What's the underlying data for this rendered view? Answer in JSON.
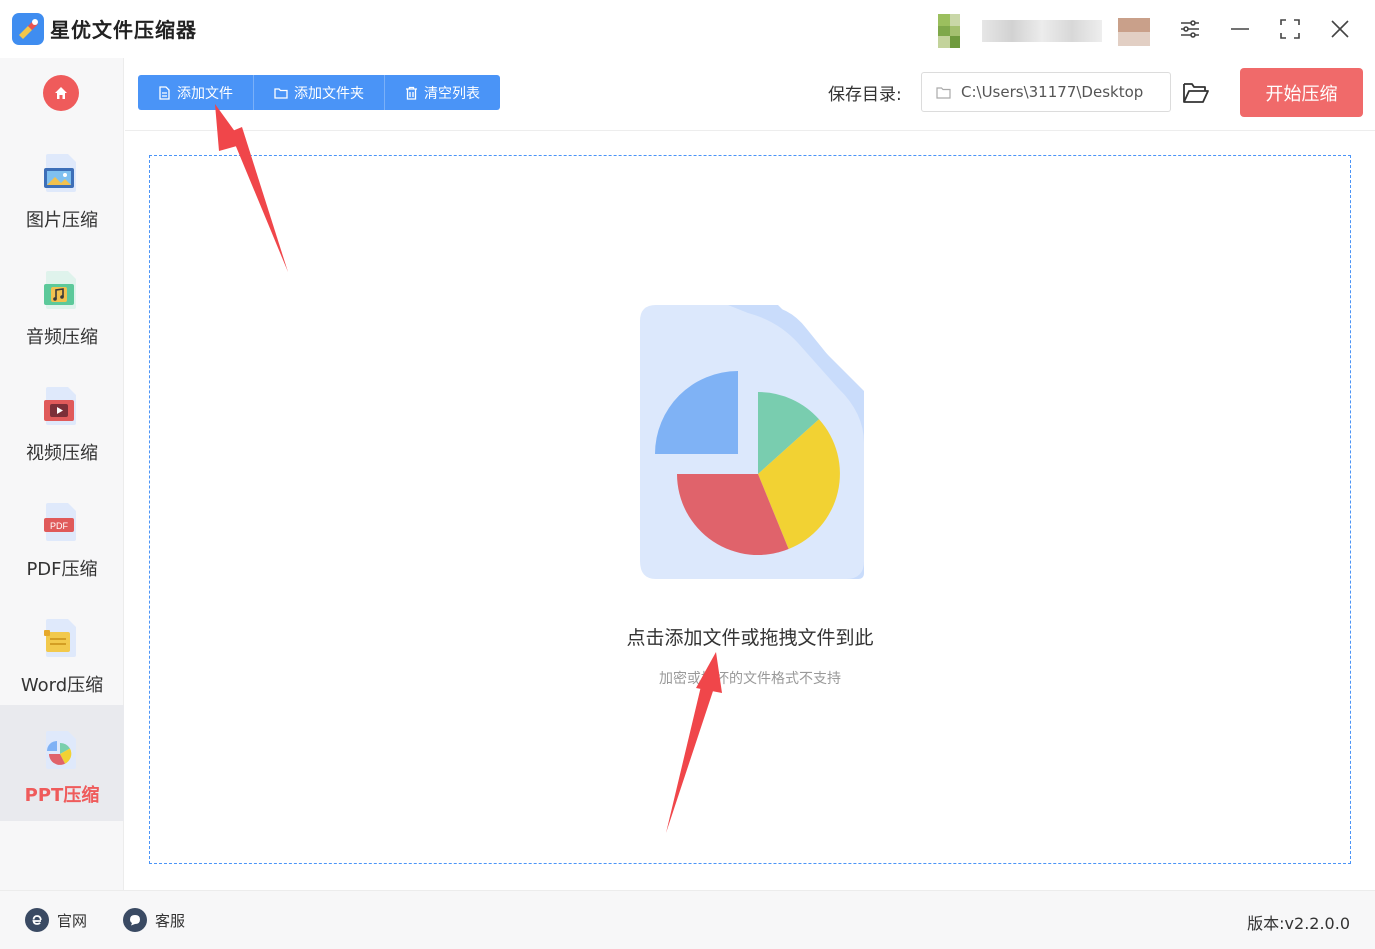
{
  "app": {
    "title": "星优文件压缩器"
  },
  "sidebar": {
    "items": [
      {
        "label": "图片压缩",
        "icon": "image-icon"
      },
      {
        "label": "音频压缩",
        "icon": "audio-icon"
      },
      {
        "label": "视频压缩",
        "icon": "video-icon"
      },
      {
        "label": "PDF压缩",
        "icon": "pdf-icon",
        "badge": "PDF"
      },
      {
        "label": "Word压缩",
        "icon": "word-icon"
      },
      {
        "label": "PPT压缩",
        "icon": "ppt-icon",
        "active": true
      }
    ]
  },
  "toolbar": {
    "add_file": "添加文件",
    "add_folder": "添加文件夹",
    "clear_list": "清空列表",
    "save_label": "保存目录:",
    "save_path": "C:\\Users\\31177\\Desktop",
    "start": "开始压缩"
  },
  "dropzone": {
    "main_text": "点击添加文件或拖拽文件到此",
    "sub_text": "加密或损坏的文件格式不支持"
  },
  "footer": {
    "website": "官网",
    "support": "客服",
    "version": "版本:v2.2.0.0"
  },
  "colors": {
    "accent_blue": "#4a94f7",
    "accent_red": "#f06a6a",
    "arrow_red": "#f0464a"
  }
}
